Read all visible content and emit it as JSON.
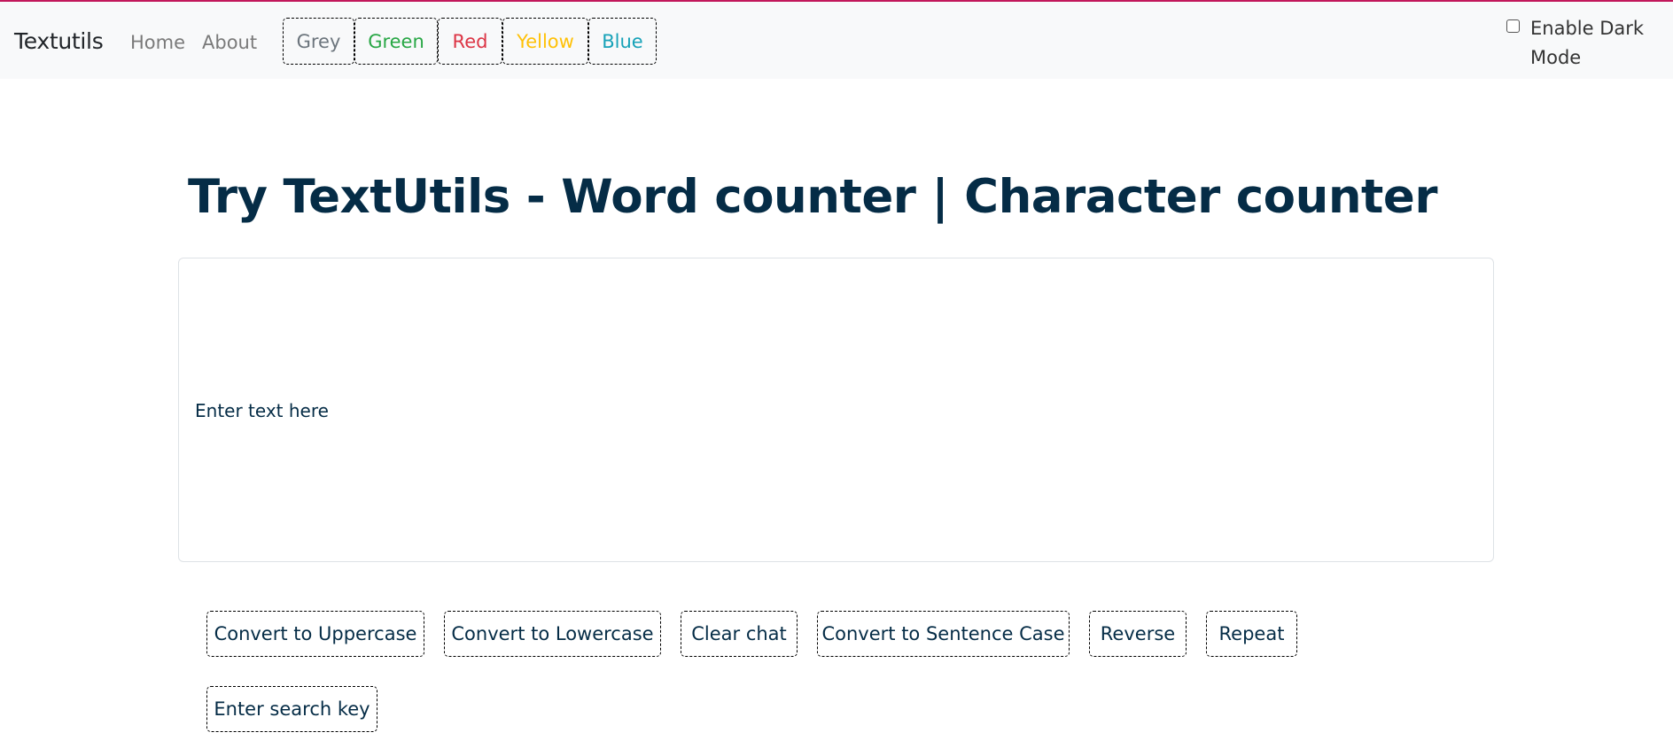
{
  "navbar": {
    "brand": "Textutils",
    "links": [
      "Home",
      "About"
    ],
    "theme_buttons": [
      {
        "label": "Grey",
        "color": "#6c757d"
      },
      {
        "label": "Green",
        "color": "#28a745"
      },
      {
        "label": "Red",
        "color": "#dc3545"
      },
      {
        "label": "Yellow",
        "color": "#ffc107"
      },
      {
        "label": "Blue",
        "color": "#17a2b8"
      }
    ],
    "dark_mode_label": "Enable Dark Mode"
  },
  "main": {
    "heading": "Try TextUtils - Word counter | Character counter",
    "textarea_placeholder": "Enter text here",
    "buttons": [
      "Convert to Uppercase",
      "Convert to Lowercase",
      "Clear chat",
      "Convert to Sentence Case",
      "Reverse",
      "Repeat",
      "Enter search key"
    ]
  }
}
